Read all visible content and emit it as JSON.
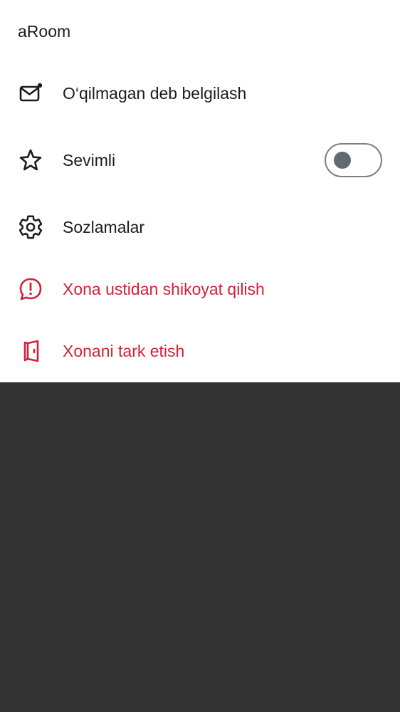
{
  "sheet": {
    "title": "aRoom",
    "items": [
      {
        "label": "O‘qilmagan deb belgilash",
        "icon": "mail-unread-icon"
      },
      {
        "label": "Sevimli",
        "icon": "star-icon",
        "toggle": {
          "on": false
        }
      },
      {
        "label": "Sozlamalar",
        "icon": "gear-icon"
      },
      {
        "label": "Xona ustidan shikoyat qilish",
        "icon": "report-icon",
        "danger": true
      },
      {
        "label": "Xonani tark etish",
        "icon": "leave-room-icon",
        "danger": true
      }
    ]
  },
  "colors": {
    "text": "#1c1c1c",
    "danger": "#d52038",
    "overlay": "#333333",
    "toggle_off": "#636970"
  }
}
